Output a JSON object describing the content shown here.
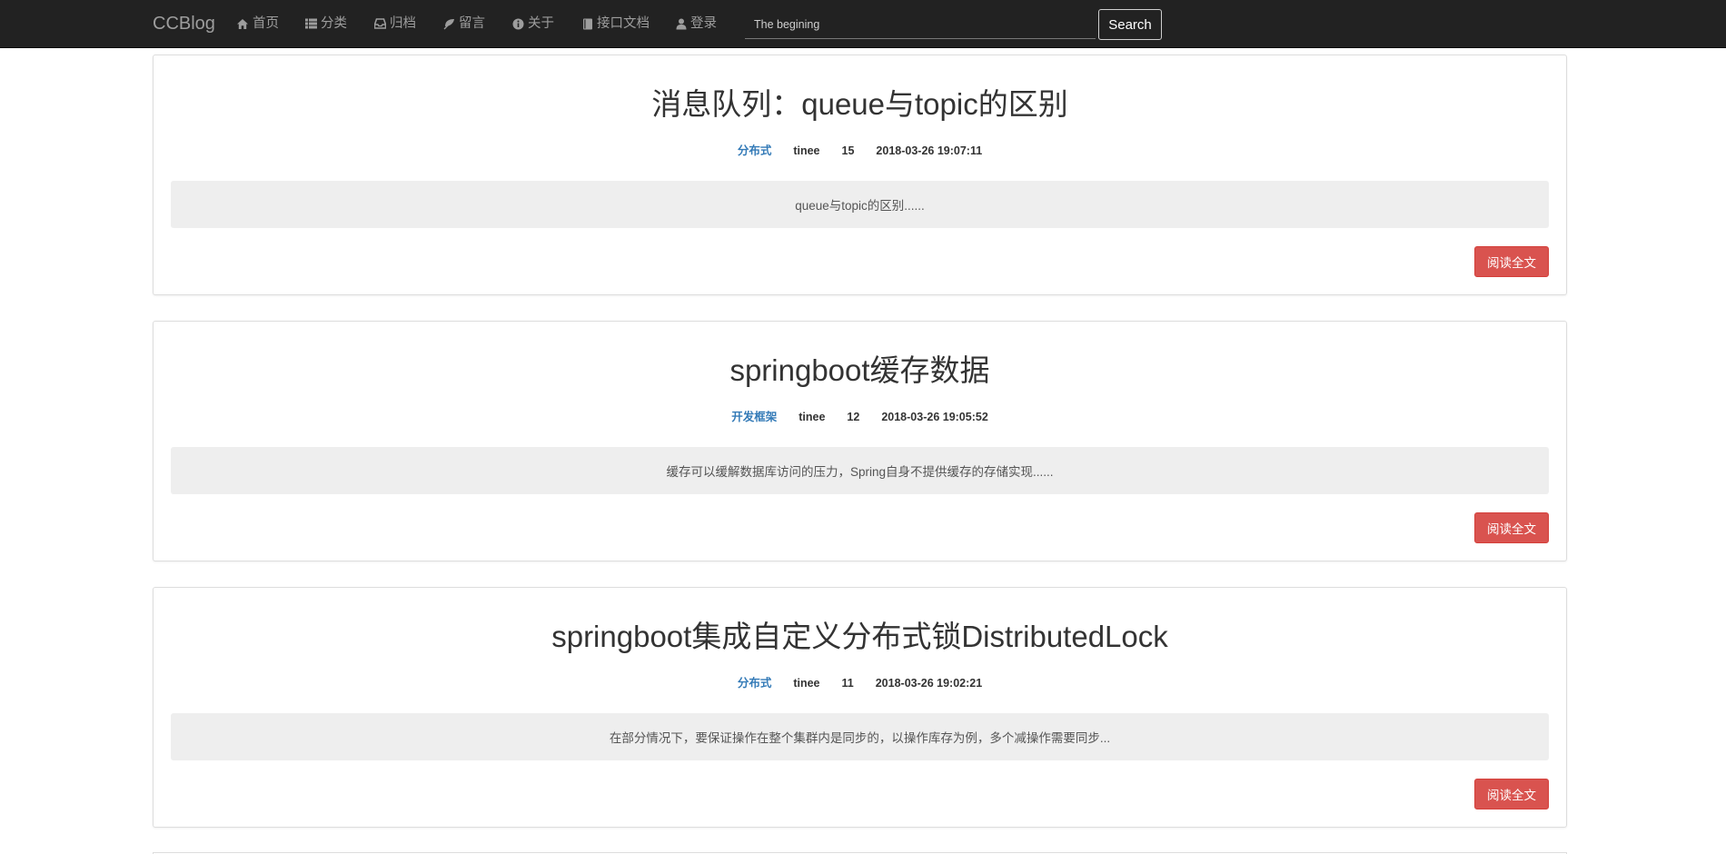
{
  "navbar": {
    "brand": "CCBlog",
    "items": [
      {
        "label": "首页",
        "icon": "home-icon"
      },
      {
        "label": "分类",
        "icon": "list-icon"
      },
      {
        "label": "归档",
        "icon": "inbox-icon"
      },
      {
        "label": "留言",
        "icon": "leaf-icon"
      },
      {
        "label": "关于",
        "icon": "info-circle-icon"
      },
      {
        "label": "接口文档",
        "icon": "book-icon"
      },
      {
        "label": "登录",
        "icon": "user-icon"
      }
    ],
    "search": {
      "value": "The begining",
      "button": "Search"
    }
  },
  "colors": {
    "navbar_bg": "#222222",
    "nav_text": "#9d9d9d",
    "category_link": "#337ab7",
    "read_button": "#d9534f",
    "summary_bg": "#eeeeee"
  },
  "posts": [
    {
      "title": "消息队列：queue与topic的区别",
      "category": "分布式",
      "author": "tinee",
      "views": "15",
      "date": "2018-03-26 19:07:11",
      "summary": "queue与topic的区别......",
      "read_more": "阅读全文"
    },
    {
      "title": "springboot缓存数据",
      "category": "开发框架",
      "author": "tinee",
      "views": "12",
      "date": "2018-03-26 19:05:52",
      "summary": "缓存可以缓解数据库访问的压力，Spring自身不提供缓存的存储实现......",
      "read_more": "阅读全文"
    },
    {
      "title": "springboot集成自定义分布式锁DistributedLock",
      "category": "分布式",
      "author": "tinee",
      "views": "11",
      "date": "2018-03-26 19:02:21",
      "summary": "在部分情况下，要保证操作在整个集群内是同步的，以操作库存为例，多个减操作需要同步...",
      "read_more": "阅读全文"
    }
  ]
}
